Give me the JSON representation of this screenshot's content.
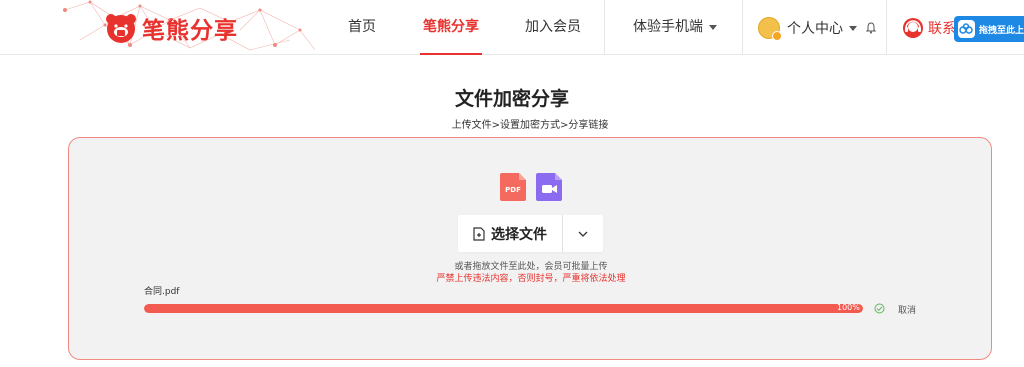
{
  "brand": {
    "name": "笔熊分享",
    "accent": "#e8322e"
  },
  "nav": {
    "items": [
      {
        "label": "首页"
      },
      {
        "label": "笔熊分享"
      },
      {
        "label": "加入会员"
      },
      {
        "label": "体验手机端"
      }
    ],
    "user_center": "个人中心",
    "contact": "联系",
    "float_button": "拖拽至此上"
  },
  "page": {
    "title": "文件加密分享",
    "breadcrumb": "上传文件>设置加密方式>分享链接"
  },
  "upload": {
    "file_type_icons": [
      "PDF",
      "video-icon"
    ],
    "select_button": "选择文件",
    "hint": "或者拖放文件至此处，会员可批量上传",
    "warning": "严禁上传违法内容，否则封号，严重将依法处理",
    "file": {
      "name": "合同.pdf",
      "progress": 100,
      "progress_label": "100%",
      "cancel_label": "取消"
    }
  }
}
